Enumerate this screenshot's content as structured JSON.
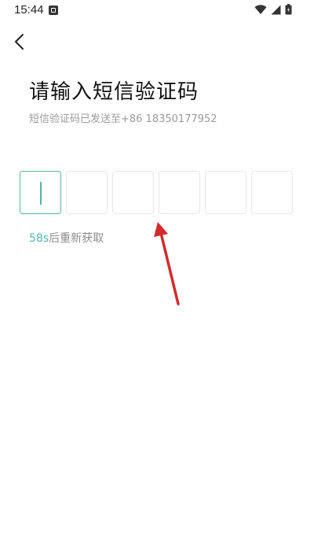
{
  "status_bar": {
    "time": "15:44",
    "icons": [
      "app-notification-icon",
      "wifi-icon",
      "signal-icon",
      "battery-icon"
    ]
  },
  "nav": {
    "back_icon": "chevron-left-icon"
  },
  "header": {
    "title": "请输入短信验证码",
    "subtitle": "短信验证码已发送至+86 18350177952"
  },
  "code_input": {
    "box_count": 6,
    "values": [
      "",
      "",
      "",
      "",
      "",
      ""
    ],
    "active_index": 0
  },
  "resend": {
    "countdown": "58s",
    "label": "后重新获取"
  },
  "colors": {
    "accent": "#53b7a8",
    "annotation": "#d42a2a"
  }
}
